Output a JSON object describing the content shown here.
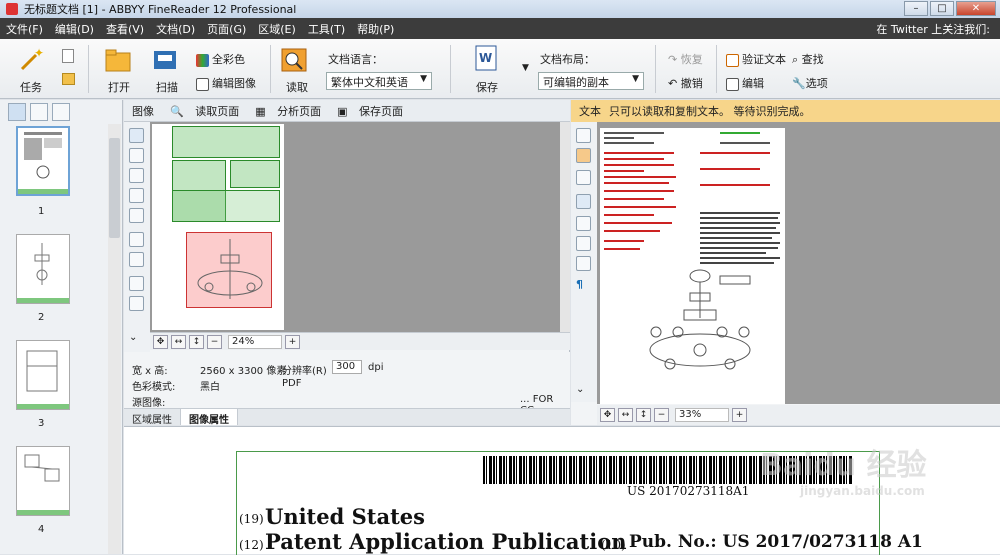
{
  "window": {
    "title": "无标题文档 [1] - ABBYY FineReader 12 Professional"
  },
  "menu": {
    "items": [
      "文件(F)",
      "编辑(D)",
      "查看(V)",
      "文档(D)",
      "页面(G)",
      "区域(E)",
      "工具(T)",
      "帮助(P)"
    ],
    "right_text": "在 Twitter 上关注我们:"
  },
  "ribbon": {
    "task_label": "任务",
    "open_label": "打开",
    "scan_label": "扫描",
    "full_color_label": "全彩色",
    "edit_image_label": "编辑图像",
    "read_label": "读取",
    "doc_language_label": "文档语言：",
    "doc_language_value": "繁体中文和英语",
    "save_label": "保存",
    "doc_layout_label": "文档布局：",
    "doc_layout_value": "可编辑的副本",
    "redo_label": "恢复",
    "undo_label": "撤销",
    "verify_text_label": "验证文本",
    "edit_label": "编辑",
    "find_label": "查找",
    "options_label": "选项"
  },
  "thumbnails": [
    {
      "num": "1",
      "selected": true
    },
    {
      "num": "2",
      "selected": false
    },
    {
      "num": "3",
      "selected": false
    },
    {
      "num": "4",
      "selected": false
    }
  ],
  "image_pane": {
    "title": "图像",
    "read_page": "读取页面",
    "analyze_page": "分析页面",
    "save_page": "保存页面",
    "zoom": "24%",
    "props": {
      "size_label": "宽 x 高:",
      "size_value": "2560 x 3300 像素",
      "resolution_label": "分辨率(R)",
      "resolution_value": "300",
      "resolution_unit": "dpi",
      "color_label": "色彩模式:",
      "color_value": "黑白",
      "format_value": "PDF",
      "source_label": "源图像:",
      "source_value": "... FOR CC"
    },
    "tabs": [
      "区域属性",
      "图像属性"
    ]
  },
  "text_pane": {
    "title": "文本",
    "message": "只可以读取和复制文本。 等待识别完成。",
    "zoom": "33%"
  },
  "zoomed_page": {
    "line19_num": "(19)",
    "line19_text": "United States",
    "line12_num": "(12)",
    "line12_text": "Patent Application Publication",
    "pubno_num": "(10)",
    "pubno_text": "Pub. No.: US 2017/0273118 A1",
    "barcode_text": "US 20170273118A1"
  },
  "watermark": {
    "main": "Baidu 经验",
    "sub": "jingyan.baidu.com"
  }
}
